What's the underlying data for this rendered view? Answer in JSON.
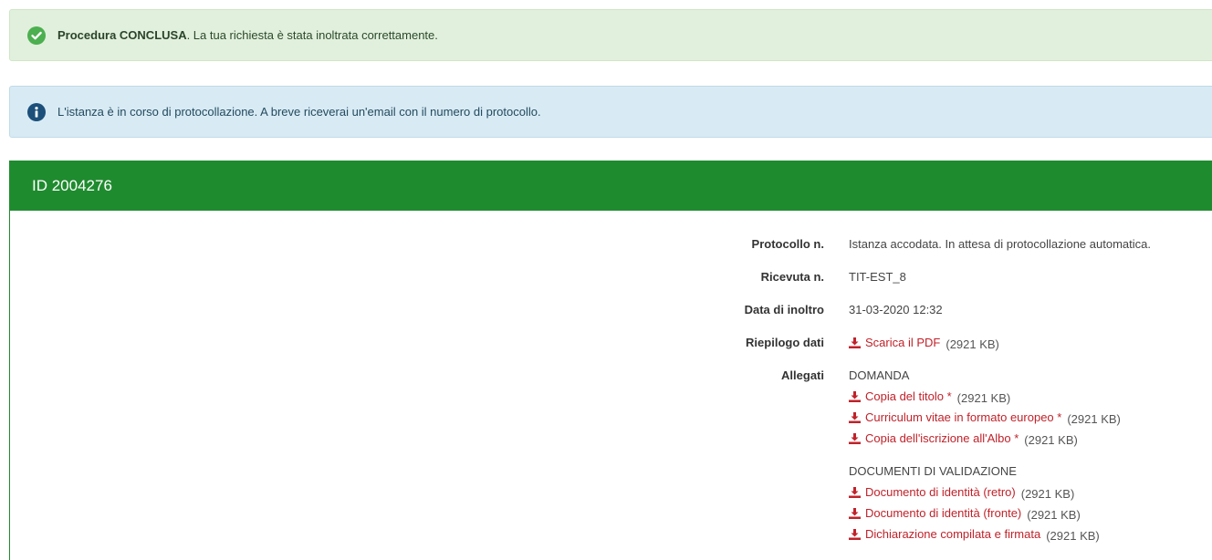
{
  "success_alert": {
    "strong": "Procedura CONCLUSA",
    "rest": ". La tua richiesta è stata inoltrata correttamente."
  },
  "info_alert": {
    "text": "L'istanza è in corso di protocollazione. A breve riceverai un'email con il numero di protocollo."
  },
  "panel": {
    "title": "ID 2004276"
  },
  "details": {
    "protocollo_label": "Protocollo n.",
    "protocollo_value": "Istanza accodata. In attesa di protocollazione automatica.",
    "ricevuta_label": "Ricevuta n.",
    "ricevuta_value": "TIT-EST_8",
    "data_label": "Data di inoltro",
    "data_value": "31-03-2020 12:32",
    "riepilogo_label": "Riepilogo dati",
    "riepilogo_link": "Scarica il PDF",
    "riepilogo_size": "(2921 KB)",
    "allegati_label": "Allegati"
  },
  "groups": [
    {
      "title": "DOMANDA",
      "files": [
        {
          "name": "Copia del titolo *",
          "size": "(2921 KB)"
        },
        {
          "name": "Curriculum vitae in formato europeo *",
          "size": "(2921 KB)"
        },
        {
          "name": "Copia dell'iscrizione all'Albo *",
          "size": "(2921 KB)"
        }
      ]
    },
    {
      "title": "DOCUMENTI DI VALIDAZIONE",
      "files": [
        {
          "name": "Documento di identità (retro)",
          "size": "(2921 KB)"
        },
        {
          "name": "Documento di identità (fronte)",
          "size": "(2921 KB)"
        },
        {
          "name": "Dichiarazione compilata e firmata",
          "size": "(2921 KB)"
        }
      ]
    }
  ],
  "colors": {
    "brand_green": "#1f8b2f",
    "success_bg": "#e1f0dc",
    "info_bg": "#d8ebf4",
    "link_red": "#c0222a"
  },
  "icons": {
    "success": "check-circle-icon",
    "info": "info-circle-icon",
    "download": "download-icon"
  }
}
